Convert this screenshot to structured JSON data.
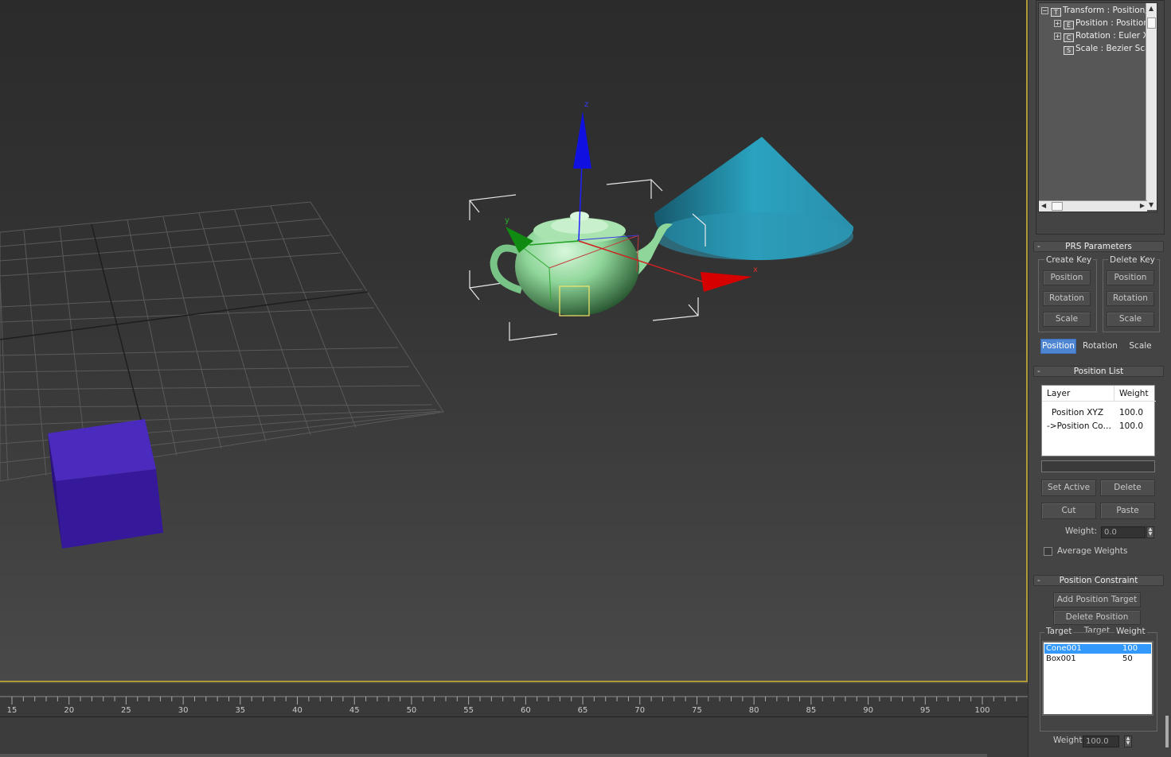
{
  "viewport": {
    "axes": {
      "x": "x",
      "y": "y",
      "z": "z"
    }
  },
  "timeline": {
    "ticks": [
      "15",
      "20",
      "25",
      "30",
      "35",
      "40",
      "45",
      "50",
      "55",
      "60",
      "65",
      "70",
      "75",
      "80",
      "85",
      "90",
      "95",
      "100"
    ]
  },
  "controller_tree": {
    "rows": [
      {
        "label": "Transform : Position/",
        "icon": "T"
      },
      {
        "label": "Position : Position",
        "icon": "E"
      },
      {
        "label": "Rotation : Euler X",
        "icon": "C"
      },
      {
        "label": "Scale : Bezier Sca",
        "icon": "S"
      }
    ]
  },
  "prs": {
    "title": "PRS Parameters",
    "collapse": "-",
    "create_key": "Create Key",
    "delete_key": "Delete Key",
    "position": "Position",
    "rotation": "Rotation",
    "scale": "Scale",
    "tabs": {
      "position": "Position",
      "rotation": "Rotation",
      "scale": "Scale"
    }
  },
  "position_list": {
    "title": "Position List",
    "collapse": "-",
    "col_layer": "Layer",
    "col_weight": "Weight",
    "rows": [
      {
        "layer": "Position XYZ",
        "weight": "100.0"
      },
      {
        "layer": "->Position Co…",
        "weight": "100.0"
      }
    ],
    "set_active": "Set Active",
    "delete": "Delete",
    "cut": "Cut",
    "paste": "Paste",
    "weight_label": "Weight:",
    "weight_value": "0.0",
    "average_weights": "Average Weights"
  },
  "position_constraint": {
    "title": "Position Constraint",
    "collapse": "-",
    "add_target": "Add Position Target",
    "delete_target": "Delete Position Target",
    "col_target": "Target",
    "col_weight": "Weight",
    "targets": [
      {
        "name": "Cone001",
        "weight": "100"
      },
      {
        "name": "Box001",
        "weight": "50"
      }
    ],
    "weight_label": "Weight",
    "weight_value": "100.0"
  },
  "colors": {
    "teapot": "#8fd69a",
    "cone": "#2aa3c0",
    "box": "#3b1fa0",
    "viewport_border": "#b09a3a",
    "selected": "#3399ff"
  }
}
